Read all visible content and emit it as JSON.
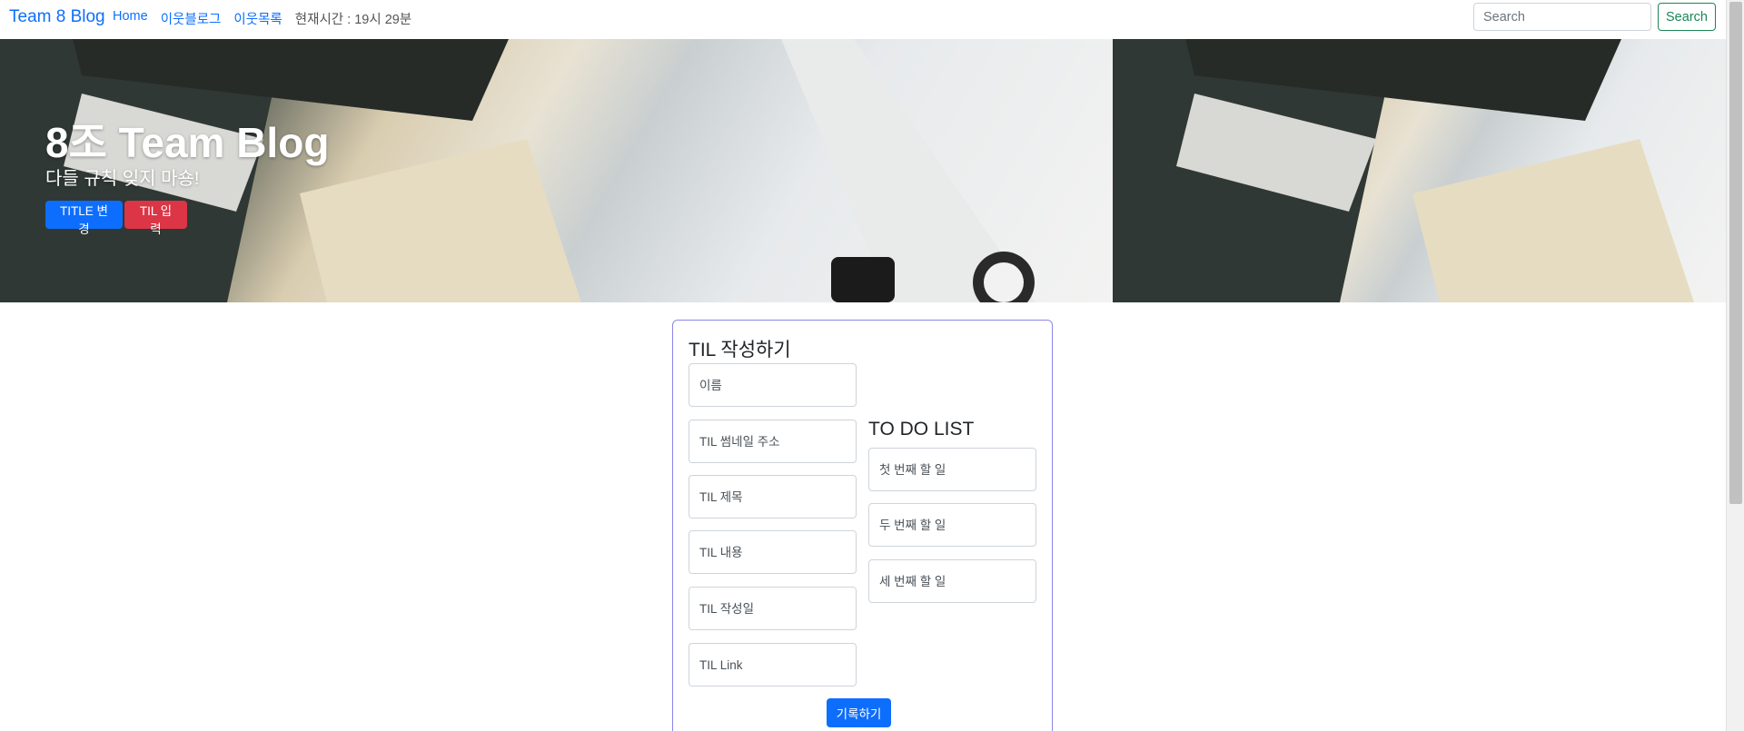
{
  "navbar": {
    "brand": "Team 8 Blog",
    "links": [
      "Home",
      "이웃블로그",
      "이웃목록"
    ],
    "time_text": "현재시간 : 19시 29분",
    "search_placeholder": "Search",
    "search_button": "Search"
  },
  "hero": {
    "title": "8조 Team Blog",
    "subtitle": "다들 규칙 잊지 마숑!",
    "title_button": "TITLE 변경",
    "til_button": "TIL 입력"
  },
  "form": {
    "title": "TIL 작성하기",
    "fields": [
      "이름",
      "TIL 썸네일 주소",
      "TIL 제목",
      "TIL 내용",
      "TIL 작성일",
      "TIL Link"
    ],
    "todo_title": "TO DO LIST",
    "todos": [
      "첫 번째 할 일",
      "두 번째 할 일",
      "세 번째 할 일"
    ],
    "submit": "기록하기"
  },
  "colors": {
    "primary": "#0d6efd",
    "danger": "#dc3545",
    "success": "#198754",
    "card_border": "#8b86e8"
  }
}
